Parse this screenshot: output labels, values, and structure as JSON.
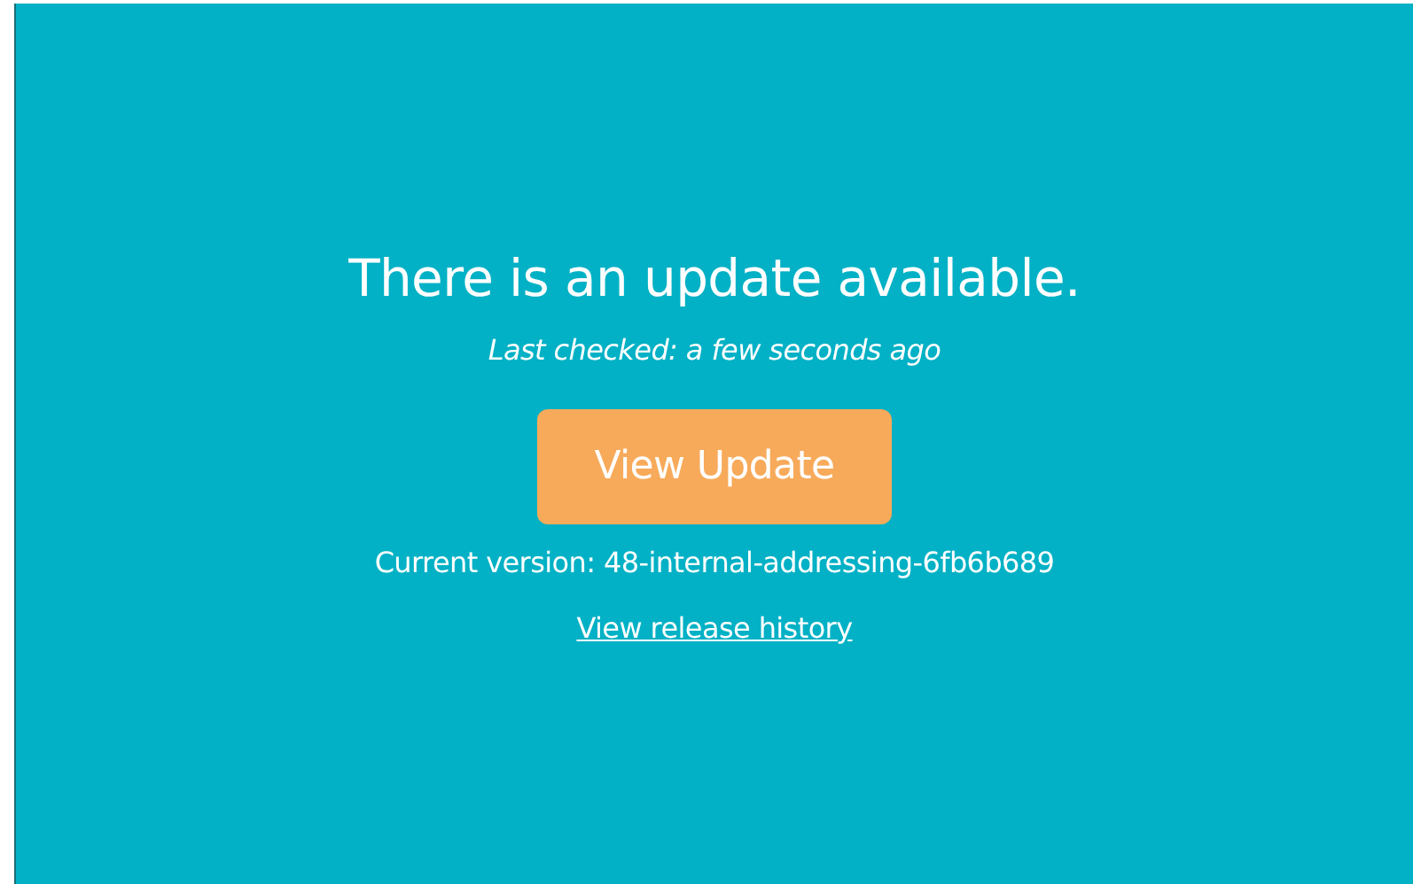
{
  "heading": "There is an update available.",
  "last_checked": "Last checked: a few seconds ago",
  "button": "View Update",
  "current_version": "Current version: 48-internal-addressing-6fb6b689",
  "link": "View release history"
}
